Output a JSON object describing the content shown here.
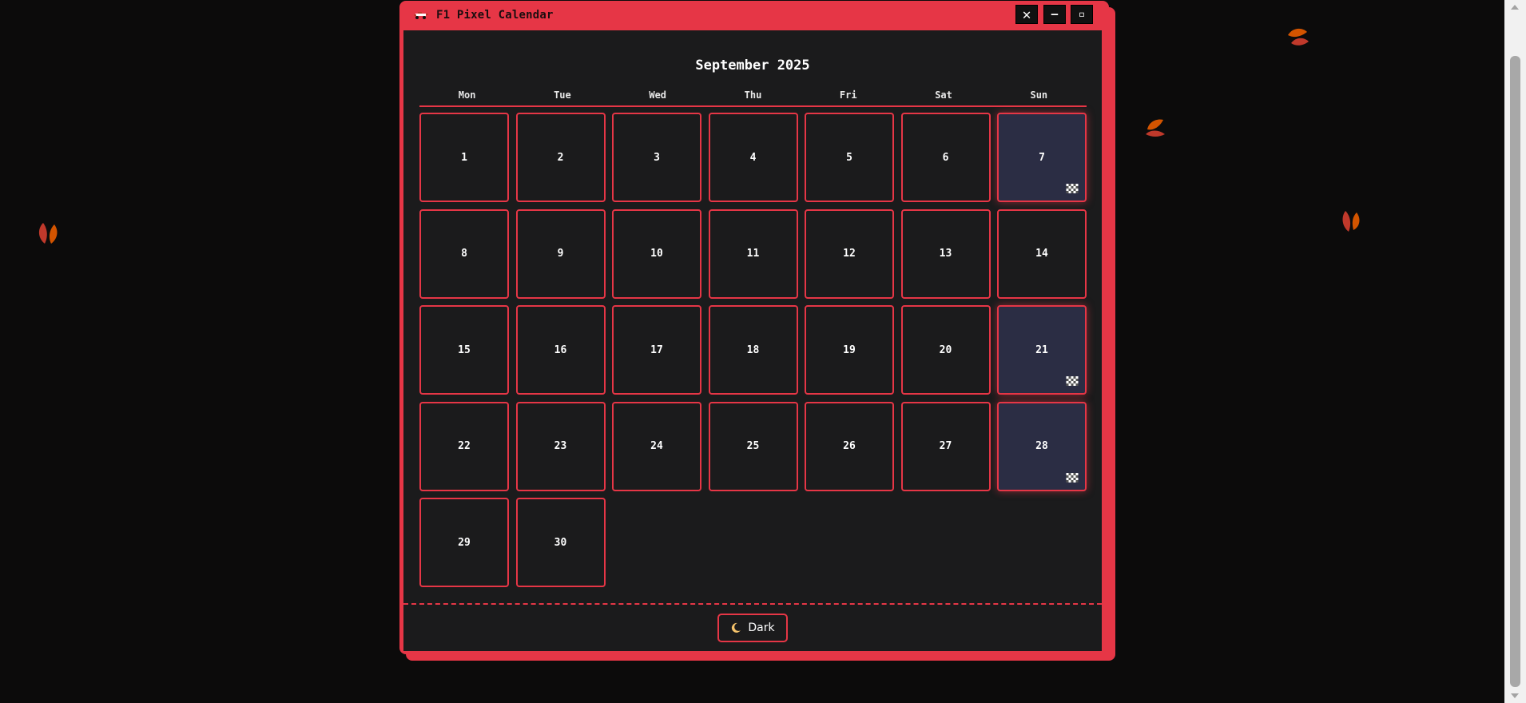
{
  "window": {
    "title": "F1 Pixel Calendar",
    "title_icon": "race-car-icon",
    "controls": {
      "close_label": "✕",
      "minimize_label": "–",
      "maximize_label": "▫"
    }
  },
  "calendar": {
    "month_title": "September 2025",
    "weekdays": [
      "Mon",
      "Tue",
      "Wed",
      "Thu",
      "Fri",
      "Sat",
      "Sun"
    ],
    "leading_empty_days": 0,
    "days": [
      {
        "label": "1"
      },
      {
        "label": "2"
      },
      {
        "label": "3"
      },
      {
        "label": "4"
      },
      {
        "label": "5"
      },
      {
        "label": "6"
      },
      {
        "label": "7",
        "race": true
      },
      {
        "label": "8"
      },
      {
        "label": "9"
      },
      {
        "label": "10"
      },
      {
        "label": "11"
      },
      {
        "label": "12"
      },
      {
        "label": "13"
      },
      {
        "label": "14"
      },
      {
        "label": "15"
      },
      {
        "label": "16"
      },
      {
        "label": "17"
      },
      {
        "label": "18"
      },
      {
        "label": "19"
      },
      {
        "label": "20"
      },
      {
        "label": "21",
        "race": true
      },
      {
        "label": "22"
      },
      {
        "label": "23"
      },
      {
        "label": "24"
      },
      {
        "label": "25"
      },
      {
        "label": "26"
      },
      {
        "label": "27"
      },
      {
        "label": "28",
        "race": true
      },
      {
        "label": "29"
      },
      {
        "label": "30"
      }
    ],
    "race_icon": "checkered-flag-icon"
  },
  "footer": {
    "theme_button_label": "Dark",
    "theme_icon": "moon-icon"
  },
  "colors": {
    "accent": "#e63646",
    "background": "#0c0b0b",
    "panel": "#1b1b1c",
    "race_day": "#2b2d44"
  }
}
